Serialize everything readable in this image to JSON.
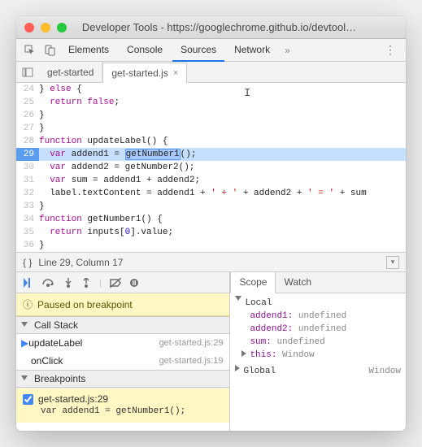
{
  "window": {
    "title": "Developer Tools - https://googlechrome.github.io/devtool…"
  },
  "main_tabs": [
    "Elements",
    "Console",
    "Sources",
    "Network"
  ],
  "main_tab_selected_index": 2,
  "file_tabs": [
    {
      "label": "get-started",
      "selected": false
    },
    {
      "label": "get-started.js",
      "selected": true
    }
  ],
  "code": {
    "lines": [
      {
        "n": 24,
        "html": "} <span class='kw'>else</span> {"
      },
      {
        "n": 25,
        "html": "  <span class='kw'>return</span> <span class='kw'>false</span>;"
      },
      {
        "n": 26,
        "html": "}"
      },
      {
        "n": 27,
        "html": "}"
      },
      {
        "n": 28,
        "html": "<span class='kw'>function</span> <span class='fn'>updateLabel</span><span class='op'>()</span> {"
      },
      {
        "n": 29,
        "hl": true,
        "html": "  <span class='kw'>var</span> addend1 = <span class='sel-word'>getNumber1</span><span class='op'>()</span>;"
      },
      {
        "n": 30,
        "html": "  <span class='kw'>var</span> addend2 = <span class='fn'>getNumber2</span><span class='op'>()</span>;"
      },
      {
        "n": 31,
        "html": "  <span class='kw'>var</span> sum = addend1 + addend2;"
      },
      {
        "n": 32,
        "html": "  label.textContent = addend1 + <span class='str'>' + '</span> + addend2 + <span class='str'>' = '</span> + sum"
      },
      {
        "n": 33,
        "html": "}"
      },
      {
        "n": 34,
        "html": "<span class='kw'>function</span> <span class='fn'>getNumber1</span><span class='op'>()</span> {"
      },
      {
        "n": 35,
        "html": "  <span class='kw'>return</span> inputs[<span class='num'>0</span>].value;"
      },
      {
        "n": 36,
        "html": "}"
      }
    ]
  },
  "status": {
    "text": "Line 29, Column 17"
  },
  "debugger": {
    "paused_msg": "Paused on breakpoint",
    "call_stack_label": "Call Stack",
    "call_stack": [
      {
        "fn": "updateLabel",
        "loc": "get-started.js:29",
        "current": true
      },
      {
        "fn": "onClick",
        "loc": "get-started.js:19",
        "current": false
      }
    ],
    "breakpoints_label": "Breakpoints",
    "breakpoints": [
      {
        "checked": true,
        "label": "get-started.js:29",
        "code": "var addend1 = getNumber1();"
      }
    ],
    "scope_tabs": [
      "Scope",
      "Watch"
    ],
    "scope_selected_index": 0,
    "scope": {
      "local_label": "Local",
      "local": [
        {
          "k": "addend1",
          "v": "undefined"
        },
        {
          "k": "addend2",
          "v": "undefined"
        },
        {
          "k": "sum",
          "v": "undefined"
        },
        {
          "k": "this",
          "v": "Window",
          "expandable": true
        }
      ],
      "global_label": "Global",
      "global_value": "Window"
    }
  }
}
